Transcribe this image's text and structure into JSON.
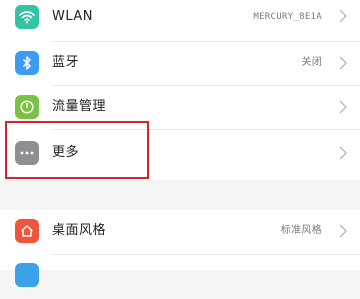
{
  "settings": {
    "items": [
      {
        "label": "WLAN",
        "value": "MERCURY_8E1A",
        "icon": "wifi-icon",
        "icon_color": "#34c2a4"
      },
      {
        "label": "蓝牙",
        "value": "关闭",
        "icon": "bluetooth-icon",
        "icon_color": "#3c9df0"
      },
      {
        "label": "流量管理",
        "value": "",
        "icon": "data-usage-icon",
        "icon_color": "#7bc143"
      },
      {
        "label": "更多",
        "value": "",
        "icon": "more-icon",
        "icon_color": "#8e8e93"
      }
    ],
    "section2": [
      {
        "label": "桌面风格",
        "value": "标准风格",
        "icon": "home-icon",
        "icon_color": "#f0553c"
      }
    ]
  },
  "annotation": {
    "highlight_color": "#d9232b"
  }
}
